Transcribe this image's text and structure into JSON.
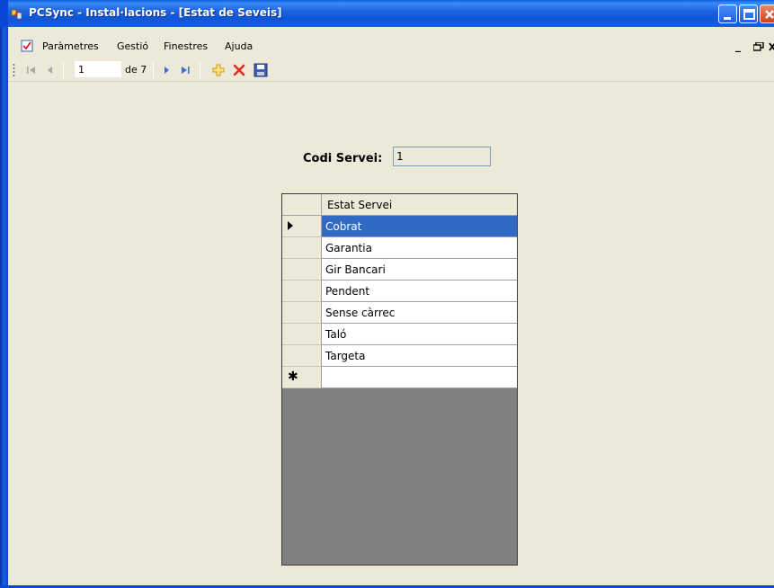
{
  "window": {
    "title": "PCSync - Instal·lacions - [Estat de Seveis]"
  },
  "menu": {
    "items": [
      "Paràmetres",
      "Gestió",
      "Finestres",
      "Ajuda"
    ],
    "mdi_minimize": "_",
    "mdi_restore": "🗗"
  },
  "navigator": {
    "position": "1",
    "count_label": "de 7"
  },
  "form": {
    "codi_label": "Codi Servei:",
    "codi_value": "1"
  },
  "grid": {
    "column_header": "Estat Servei",
    "rows": [
      "Cobrat",
      "Garantia",
      "Gir Bancari",
      "Pendent",
      "Sense càrrec",
      "Taló",
      "Targeta"
    ],
    "selected_index": 0,
    "new_row_marker": "✱"
  },
  "colors": {
    "titlebar": "#1c64e2",
    "selection": "#316ac5",
    "window_bg": "#ece9d8",
    "grid_bg": "#808080"
  }
}
